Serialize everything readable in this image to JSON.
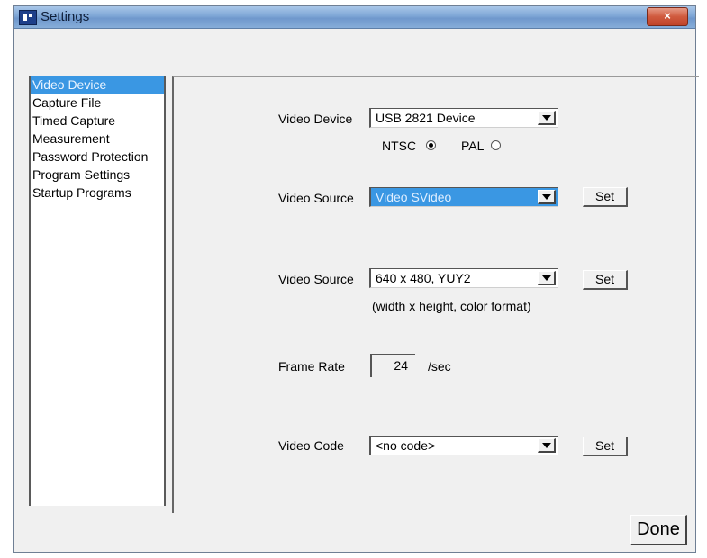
{
  "window": {
    "title": "Settings",
    "close_label": "×"
  },
  "sidebar": {
    "items": [
      {
        "label": "Video Device",
        "active": true
      },
      {
        "label": "Capture File"
      },
      {
        "label": "Timed Capture"
      },
      {
        "label": "Measurement"
      },
      {
        "label": "Password Protection"
      },
      {
        "label": "Program Settings"
      },
      {
        "label": "Startup Programs"
      }
    ]
  },
  "form": {
    "video_device": {
      "label": "Video Device",
      "value": "USB 2821 Device",
      "ntsc_label": "NTSC",
      "pal_label": "PAL",
      "selected_standard": "NTSC"
    },
    "video_source": {
      "label": "Video Source",
      "value": "Video SVideo",
      "set_label": "Set"
    },
    "video_format": {
      "label": "Video Source",
      "value": "640 x 480, YUY2",
      "hint": "(width x height, color format)",
      "set_label": "Set"
    },
    "frame_rate": {
      "label": "Frame Rate",
      "value": "24",
      "unit": "/sec"
    },
    "video_code": {
      "label": "Video Code",
      "value": "<no code>",
      "set_label": "Set"
    }
  },
  "footer": {
    "done_label": "Done"
  },
  "colors": {
    "selection": "#3a97e3",
    "window_bg": "#f0f0f0",
    "titlebar": "#7ea6d6"
  }
}
